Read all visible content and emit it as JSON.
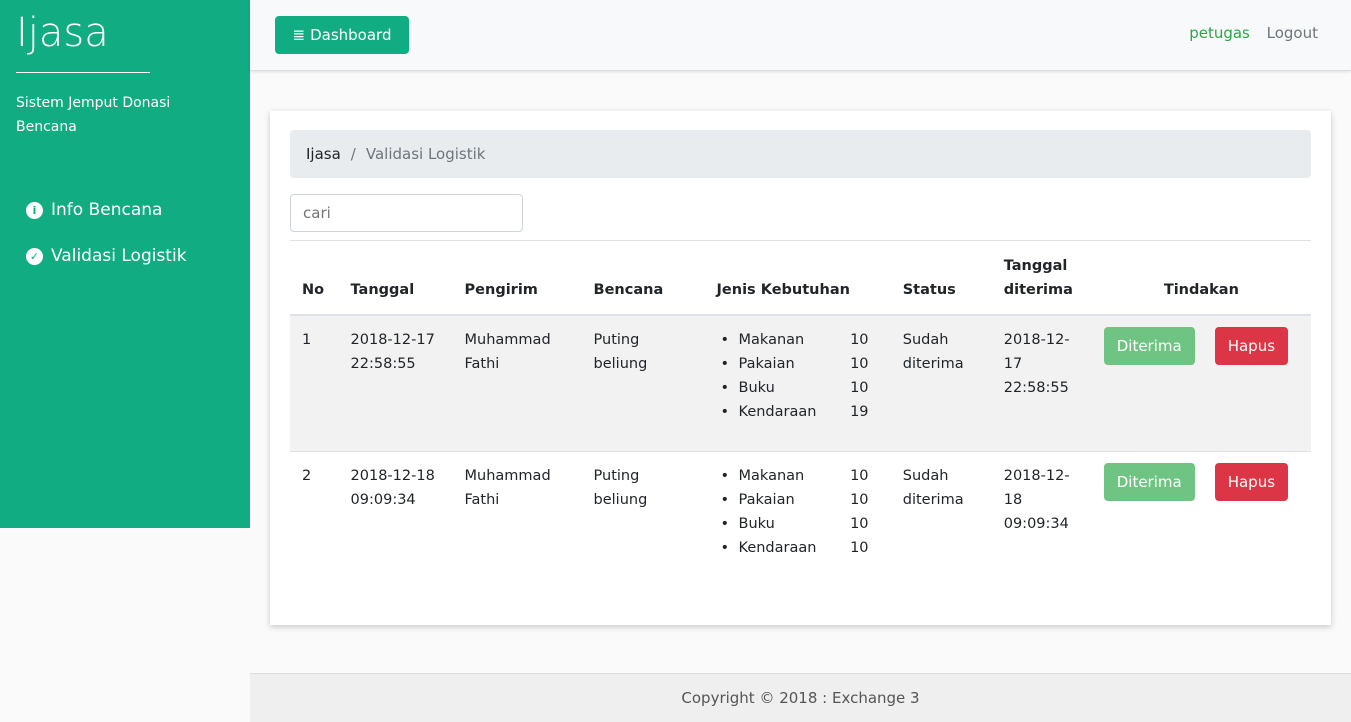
{
  "sidebar": {
    "brand": "Ijasa",
    "tagline": "Sistem Jemput Donasi Bencana",
    "items": [
      {
        "label": "Info Bencana",
        "icon": "info-circle-icon"
      },
      {
        "label": "Validasi Logistik",
        "icon": "check-circle-icon"
      }
    ]
  },
  "topbar": {
    "dashboard_label": "Dashboard",
    "user": "petugas",
    "logout": "Logout"
  },
  "breadcrumb": {
    "home": "Ijasa",
    "sep": "/",
    "current": "Validasi Logistik"
  },
  "search": {
    "placeholder": "cari"
  },
  "table": {
    "headers": [
      "No",
      "Tanggal",
      "Pengirim",
      "Bencana",
      "Jenis Kebutuhan",
      "Status",
      "Tanggal diterima",
      "Tindakan"
    ],
    "rows": [
      {
        "no": "1",
        "tanggal": "2018-12-17 22:58:55",
        "pengirim": "Muhammad Fathi",
        "bencana": "Puting beliung",
        "items": [
          [
            "Makanan",
            "10"
          ],
          [
            "Pakaian",
            "10"
          ],
          [
            "Buku",
            "10"
          ],
          [
            "Kendaraan",
            "19"
          ]
        ],
        "status": "Sudah diterima",
        "diterima": "2018-12-17 22:58:55",
        "accept": "Diterima",
        "delete": "Hapus"
      },
      {
        "no": "2",
        "tanggal": "2018-12-18 09:09:34",
        "pengirim": "Muhammad Fathi",
        "bencana": "Puting beliung",
        "items": [
          [
            "Makanan",
            "10"
          ],
          [
            "Pakaian",
            "10"
          ],
          [
            "Buku",
            "10"
          ],
          [
            "Kendaraan",
            "10"
          ]
        ],
        "status": "Sudah diterima",
        "diterima": "2018-12-18 09:09:34",
        "accept": "Diterima",
        "delete": "Hapus"
      }
    ]
  },
  "footer": {
    "text": "Copyright © 2018 : Exchange 3"
  }
}
